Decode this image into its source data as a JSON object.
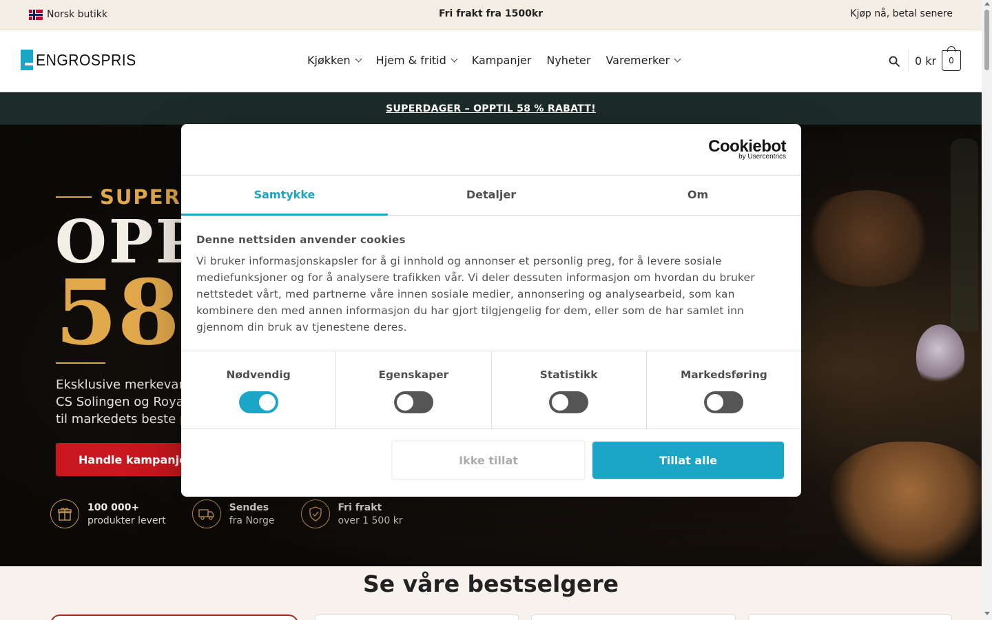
{
  "topbar": {
    "store_label": "Norsk butikk",
    "freight_label": "Fri frakt fra 1500kr",
    "paylater_label": "Kjøp nå, betal senere"
  },
  "header": {
    "logo_text": "ENGROSPRIS",
    "nav": [
      {
        "label": "Kjøkken",
        "has_dropdown": true
      },
      {
        "label": "Hjem & fritid",
        "has_dropdown": true
      },
      {
        "label": "Kampanjer",
        "has_dropdown": false
      },
      {
        "label": "Nyheter",
        "has_dropdown": false
      },
      {
        "label": "Varemerker",
        "has_dropdown": true
      }
    ],
    "cart_amount": "0 kr",
    "cart_count": "0"
  },
  "promo": {
    "label": "SUPERDAGER – OPPTIL 58 % RABATT!"
  },
  "hero": {
    "sup_label": "SUPERD",
    "opp_label": "OPP",
    "pct_label": "58",
    "desc_lines": [
      "Eksklusive merkevare",
      "CS Solingen og Royal",
      "til markedets beste p"
    ],
    "cta_label": "Handle kampanjer",
    "features": [
      {
        "icon": "gift-icon",
        "line1": "100 000+",
        "line2": "produkter levert"
      },
      {
        "icon": "truck-icon",
        "line1": "Sendes",
        "line2": "fra Norge"
      },
      {
        "icon": "shield-check-icon",
        "line1": "Fri frakt",
        "line2": "over 1 500 kr"
      }
    ]
  },
  "bestsellers": {
    "title": "Se våre bestselgere"
  },
  "cookie_dialog": {
    "brand": "Cookiebot",
    "brand_sub": "by Usercentrics",
    "tabs": [
      "Samtykke",
      "Detaljer",
      "Om"
    ],
    "active_tab": "Samtykke",
    "heading": "Denne nettsiden anvender cookies",
    "text": "Vi bruker informasjonskapsler for å gi innhold og annonser et personlig preg, for å levere sosiale mediefunksjoner og for å analysere trafikken vår. Vi deler dessuten informasjon om hvordan du bruker nettstedet vårt, med partnerne våre innen sosiale medier, annonsering og analysearbeid, som kan kombinere den med annen informasjon du har gjort tilgjengelig for dem, eller som de har samlet inn gjennom din bruk av tjenestene deres.",
    "toggles": [
      {
        "label": "Nødvendig",
        "on": true
      },
      {
        "label": "Egenskaper",
        "on": false
      },
      {
        "label": "Statistikk",
        "on": false
      },
      {
        "label": "Markedsføring",
        "on": false
      }
    ],
    "deny_label": "Ikke tillat",
    "allow_label": "Tillat alle"
  },
  "colors": {
    "accent": "#1ba6c7",
    "promo_bg": "#1d2b28",
    "topbar_bg": "#f3ede3",
    "cta_red": "#c8171e",
    "gold": "#e1a84c"
  }
}
